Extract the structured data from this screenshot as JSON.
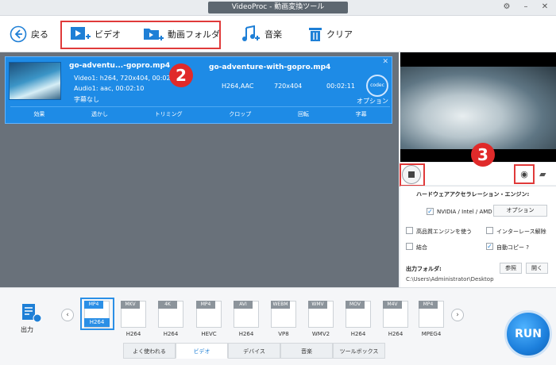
{
  "window": {
    "title": "VideoProc - 動画変換ツール"
  },
  "toolbar": {
    "back": "戻る",
    "video": "ビデオ",
    "folder": "動画フォルダ",
    "music": "音楽",
    "clear": "クリア"
  },
  "task": {
    "source_name": "go-adventu...-gopro.mp4",
    "video_info": "Video1: h264, 720x404, 00:02:11",
    "audio_info": "Audio1: aac, 00:02:10",
    "subtitle": "字幕なし",
    "output_name": "go-adventure-with-gopro.mp4",
    "codec": "H264,AAC",
    "resolution": "720x404",
    "duration": "00:02:11",
    "codec_badge": "codec",
    "option_label": "オプション",
    "actions": [
      "効果",
      "透かし",
      "トリミング",
      "クロップ",
      "回転",
      "字幕"
    ]
  },
  "steps": {
    "two": "2",
    "three": "3"
  },
  "settings": {
    "hw_title": "ハードウェアアクセラレーション・エンジン:",
    "gpu": "NVIDIA / Intel / AMD",
    "option_button": "オプション",
    "hq_engine": "高品質エンジンを使う",
    "deinterlace": "インターレース解除",
    "merge": "結合",
    "auto_copy": "自動コピー ?",
    "output_folder_label": "出力フォルダ:",
    "browse": "参照",
    "open": "開く",
    "output_path": "C:\\Users\\Administrator\\Desktop"
  },
  "output": {
    "label": "出力"
  },
  "formats": [
    {
      "top": "MP4",
      "bottom": "H264",
      "selected": true
    },
    {
      "top": "MKV",
      "bottom": "H264"
    },
    {
      "top": "4K",
      "bottom": "H264"
    },
    {
      "top": "MP4",
      "bottom": "HEVC"
    },
    {
      "top": "AVI",
      "bottom": "H264"
    },
    {
      "top": "WEBM",
      "bottom": "VP8"
    },
    {
      "top": "WMV",
      "bottom": "WMV2"
    },
    {
      "top": "MOV",
      "bottom": "H264"
    },
    {
      "top": "M4V",
      "bottom": "H264"
    },
    {
      "top": "MP4",
      "bottom": "MPEG4"
    }
  ],
  "tabs": [
    "よく使われる",
    "ビデオ",
    "デバイス",
    "音楽",
    "ツールボックス"
  ],
  "run": "RUN",
  "colors": {
    "accent": "#1e8be6",
    "highlight": "#e03a3a",
    "panel": "#69717a"
  }
}
